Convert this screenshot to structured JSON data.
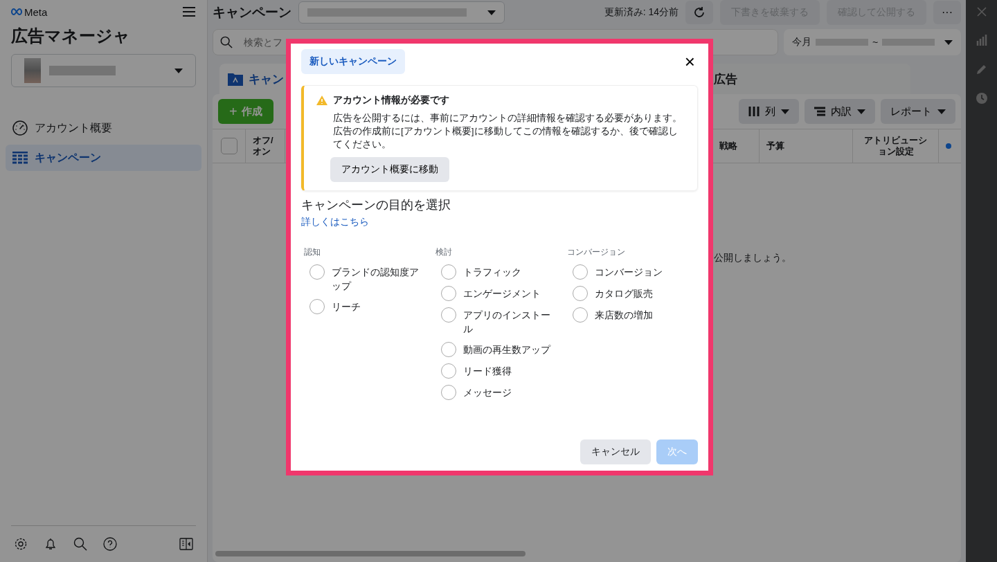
{
  "sidebar": {
    "logo": "Meta",
    "title": "広告マネージャ",
    "nav": [
      {
        "label": "アカウント概要",
        "selected": false
      },
      {
        "label": "キャンペーン",
        "selected": true
      }
    ]
  },
  "topbar": {
    "title": "キャンペーン",
    "updated": "更新済み: 14分前",
    "buttons": [
      {
        "label": "下書きを破棄する",
        "disabled": true
      },
      {
        "label": "確認して公開する",
        "disabled": true
      }
    ],
    "more": "···"
  },
  "search": {
    "placeholder": "検索とフ"
  },
  "date_range": {
    "label": "今月",
    "separator": "~"
  },
  "tabs": [
    {
      "label": "キャン",
      "selected": true
    },
    {
      "label": "広告",
      "selected": false
    }
  ],
  "toolbar": {
    "create_icon": "+",
    "create": "作成",
    "buttons": [
      {
        "label": "列"
      },
      {
        "label": "内訳"
      },
      {
        "label": "レポート"
      }
    ]
  },
  "table": {
    "select_all_checked": false,
    "columns": [
      "オフ/オン",
      "戦略",
      "予算",
      "アトリビューション設定"
    ],
    "empty_message": "公開しましょう。"
  },
  "modal": {
    "chip": "新しいキャンペーン",
    "close": "×",
    "notice": {
      "title": "アカウント情報が必要です",
      "body": "広告を公開するには、事前にアカウントの詳細情報を確認する必要があります。広告の作成前に[アカウント概要]に移動してこの情報を確認するか、後で確認してください。",
      "button": "アカウント概要に移動"
    },
    "heading": "キャンペーンの目的を選択",
    "link": "詳しくはこちら",
    "groups": [
      {
        "label": "認知",
        "options": [
          {
            "label": "ブランドの認知度アップ",
            "selected": false
          },
          {
            "label": "リーチ",
            "selected": false
          }
        ]
      },
      {
        "label": "検討",
        "options": [
          {
            "label": "トラフィック",
            "selected": false
          },
          {
            "label": "エンゲージメント",
            "selected": false
          },
          {
            "label": "アプリのインストール",
            "selected": false
          },
          {
            "label": "動画の再生数アップ",
            "selected": false
          },
          {
            "label": "リード獲得",
            "selected": false
          },
          {
            "label": "メッセージ",
            "selected": false
          }
        ]
      },
      {
        "label": "コンバージョン",
        "options": [
          {
            "label": "コンバージョン",
            "selected": false
          },
          {
            "label": "カタログ販売",
            "selected": false
          },
          {
            "label": "来店数の増加",
            "selected": false
          }
        ]
      }
    ],
    "buttons": [
      {
        "label": "キャンセル",
        "kind": "secondary",
        "disabled": false
      },
      {
        "label": "次へ",
        "kind": "primary",
        "disabled": true
      }
    ]
  }
}
